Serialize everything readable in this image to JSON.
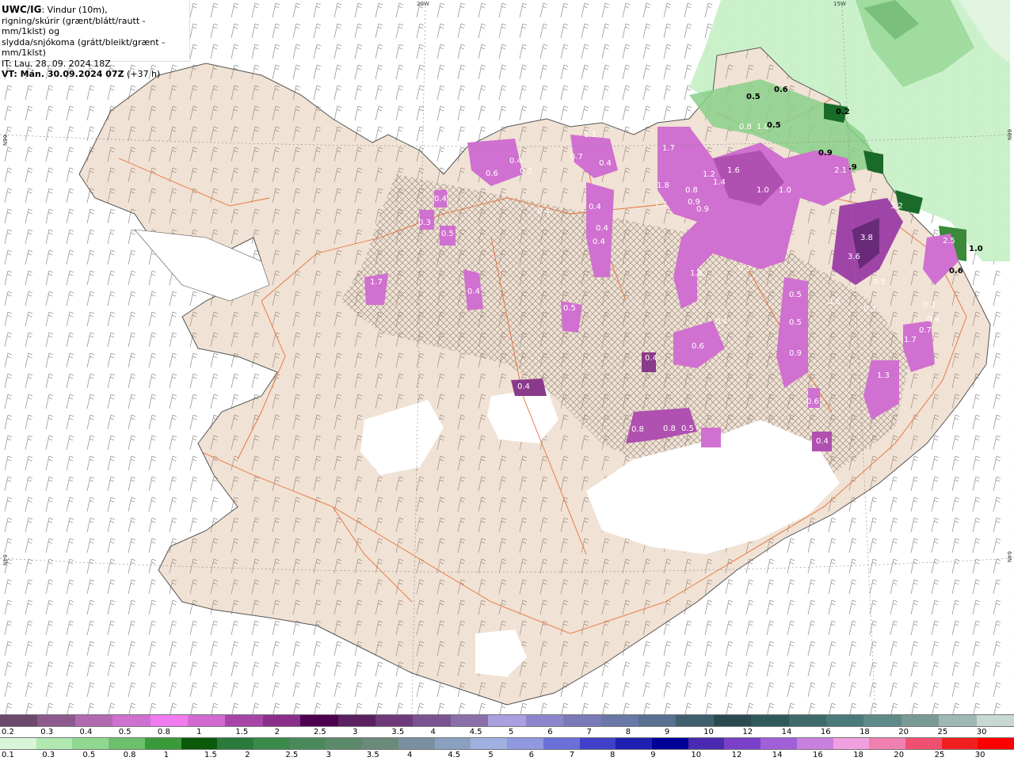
{
  "header": {
    "product": "UWC/IG",
    "line1": ": Vindur (10m),",
    "line2": "rigning/skúrir (grænt/blátt/rautt - mm/1klst) og",
    "line3": "slydda/snjókoma (grátt/bleikt/grænt - mm/1klst)",
    "it_line": "IT: Lau. 28. 09. 2024 18Z",
    "vt_label": "VT: Mán. 30.09.2024 07Z",
    "vt_offset": " (+37 h)"
  },
  "grid_labels": {
    "lon_20w": "20W",
    "lon_15w": "15W",
    "lat_66n_left": "66N",
    "lat_66n_right": "66N",
    "lat_64n_left": "64N",
    "lat_64n_right": "64N"
  },
  "legend_snow": {
    "colors": [
      "#6b4a6b",
      "#8c5a8c",
      "#b06ab0",
      "#d070d0",
      "#f07cf0",
      "#d26ad2",
      "#a845a8",
      "#8a2f8a",
      "#4d004d",
      "#5a2060",
      "#6e3a7a",
      "#7a5490",
      "#8a6fa8",
      "#a9a0e0",
      "#8e86cc",
      "#7a7ab8",
      "#6a78a8",
      "#5a7090",
      "#40606e",
      "#2a4a50",
      "#2e5a5a",
      "#3e6a6a",
      "#4a7a7a",
      "#5e8a88",
      "#7a9a96",
      "#a0b8b4",
      "#c8d8d4"
    ],
    "labels": [
      "0.2",
      "0.3",
      "0.4",
      "0.5",
      "0.8",
      "1",
      "1.5",
      "2",
      "2.5",
      "3",
      "3.5",
      "4",
      "4.5",
      "5",
      "6",
      "7",
      "8",
      "9",
      "10",
      "12",
      "14",
      "16",
      "18",
      "20",
      "25",
      "30"
    ]
  },
  "legend_rain": {
    "colors": [
      "#d8f5d8",
      "#b0e8b0",
      "#90d890",
      "#6cc06c",
      "#3a9a3a",
      "#0a5a0a",
      "#2a7a3a",
      "#3a8a4a",
      "#4a8a5a",
      "#5a8a6a",
      "#6a8a7a",
      "#7a90a0",
      "#8aa0c0",
      "#a0b0e0",
      "#9098e0",
      "#6a70d8",
      "#4040c8",
      "#2020b0",
      "#000099",
      "#4a2ab0",
      "#7a40c8",
      "#a060d8",
      "#c880e0",
      "#f0a0e0",
      "#f080b0",
      "#f05070",
      "#f02020",
      "#ff0000"
    ],
    "labels": [
      "0.1",
      "0.3",
      "0.5",
      "0.8",
      "1",
      "1.5",
      "2",
      "2.5",
      "3",
      "3.5",
      "4",
      "4.5",
      "5",
      "6",
      "7",
      "8",
      "9",
      "10",
      "12",
      "14",
      "16",
      "18",
      "20",
      "25",
      "30"
    ]
  },
  "map_values": [
    {
      "text": "0.5",
      "dark": true
    },
    {
      "text": "0.6",
      "dark": true
    },
    {
      "text": "0.8",
      "dark": false
    },
    {
      "text": "1.0",
      "dark": false
    },
    {
      "text": "0.5",
      "dark": true
    },
    {
      "text": "0.2",
      "dark": true
    },
    {
      "text": "1.7",
      "dark": false
    },
    {
      "text": "1.2",
      "dark": false
    },
    {
      "text": "1.4",
      "dark": false
    },
    {
      "text": "1.6",
      "dark": false
    },
    {
      "text": "1.0",
      "dark": false
    },
    {
      "text": "2.1",
      "dark": false
    },
    {
      "text": "0.9",
      "dark": true
    },
    {
      "text": ".9",
      "dark": true
    },
    {
      "text": "1.8",
      "dark": false
    },
    {
      "text": "0.8",
      "dark": false
    },
    {
      "text": "0.9",
      "dark": false
    },
    {
      "text": "1.2",
      "dark": false
    },
    {
      "text": "0.9",
      "dark": false
    },
    {
      "text": "1.0",
      "dark": false
    },
    {
      "text": "3.2",
      "dark": false
    },
    {
      "text": "3.8",
      "dark": false
    },
    {
      "text": "3.6",
      "dark": false
    },
    {
      "text": "2.5",
      "dark": false
    },
    {
      "text": "1.0",
      "dark": true
    },
    {
      "text": "0.6",
      "dark": true
    },
    {
      "text": "1.8",
      "dark": false
    },
    {
      "text": "0.3",
      "dark": false
    },
    {
      "text": "0.3",
      "dark": false
    },
    {
      "text": "0.5",
      "dark": false
    },
    {
      "text": "0.5",
      "dark": false
    },
    {
      "text": "0.9",
      "dark": false
    },
    {
      "text": "0.6",
      "dark": false
    },
    {
      "text": "0.4",
      "dark": false
    },
    {
      "text": "0.6",
      "dark": false
    },
    {
      "text": "0.5",
      "dark": false
    },
    {
      "text": "0.5",
      "dark": false
    },
    {
      "text": "0.4",
      "dark": false
    },
    {
      "text": "0.4",
      "dark": false
    },
    {
      "text": "1.7",
      "dark": false
    },
    {
      "text": "1.3",
      "dark": false
    },
    {
      "text": "0.4",
      "dark": false
    },
    {
      "text": "0.4",
      "dark": false
    },
    {
      "text": "1.1",
      "dark": false
    },
    {
      "text": "0.4",
      "dark": false
    },
    {
      "text": "0.7",
      "dark": false
    },
    {
      "text": "0.6",
      "dark": false
    },
    {
      "text": "0.3",
      "dark": false
    },
    {
      "text": "0.4",
      "dark": false
    },
    {
      "text": "0.4",
      "dark": false
    },
    {
      "text": "0.4",
      "dark": false
    },
    {
      "text": "0.5",
      "dark": false
    },
    {
      "text": "0.3",
      "dark": false
    },
    {
      "text": "0.4",
      "dark": false
    },
    {
      "text": "0.4",
      "dark": false
    },
    {
      "text": "0.5",
      "dark": false
    },
    {
      "text": "0.8",
      "dark": false
    },
    {
      "text": "1.7",
      "dark": false
    },
    {
      "text": "0.4",
      "dark": false
    },
    {
      "text": "0.7",
      "dark": false
    },
    {
      "text": "0.4",
      "dark": false
    },
    {
      "text": "0.3",
      "dark": false
    },
    {
      "text": "0.8",
      "dark": false
    },
    {
      "text": "0.5",
      "dark": false
    }
  ],
  "colors": {
    "land": "#f0e2d4",
    "glacier": "#ffffff",
    "snow_light": "#d070d0",
    "snow_dark": "#7a3a8a",
    "rain_light": "#c8f0c8",
    "rain_mid": "#8ad08a",
    "rain_dark": "#1a6a2a",
    "roads": "#e8703a",
    "coast": "#555555"
  }
}
